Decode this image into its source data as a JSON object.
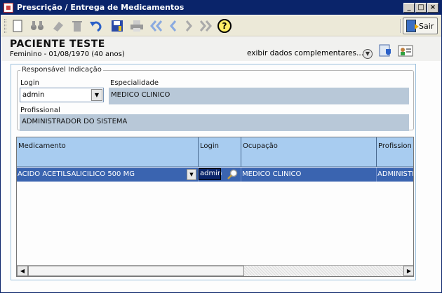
{
  "window": {
    "title": "Prescrição / Entrega de Medicamentos",
    "controls": [
      "_",
      "□",
      "×"
    ]
  },
  "toolbar": {
    "sair_label": "Sair",
    "help_label": "?"
  },
  "patient": {
    "name": "PACIENTE TESTE",
    "info": "Feminino - 01/08/1970 (40 anos)",
    "extra_link": "exibir dados complementares..."
  },
  "responsavel": {
    "legend": "Responsável Indicação",
    "login_label": "Login",
    "login_value": "admin",
    "especialidade_label": "Especialidade",
    "especialidade_value": "MEDICO CLINICO",
    "profissional_label": "Profissional",
    "profissional_value": "ADMINISTRADOR DO SISTEMA"
  },
  "grid": {
    "columns": [
      "Medicamento",
      "Login",
      "Ocupação",
      "Profission"
    ],
    "rows": [
      {
        "medicamento": "ACIDO ACETILSALICILICO 500 MG",
        "login": "admin",
        "ocupacao": "MEDICO CLINICO",
        "profissional": "ADMINISTR"
      }
    ]
  },
  "colors": {
    "titlebar": "#0a246a",
    "grid_header": "#a8ccf0",
    "selected_row": "#3a64b0",
    "readonly_field": "#b8c8d8"
  }
}
